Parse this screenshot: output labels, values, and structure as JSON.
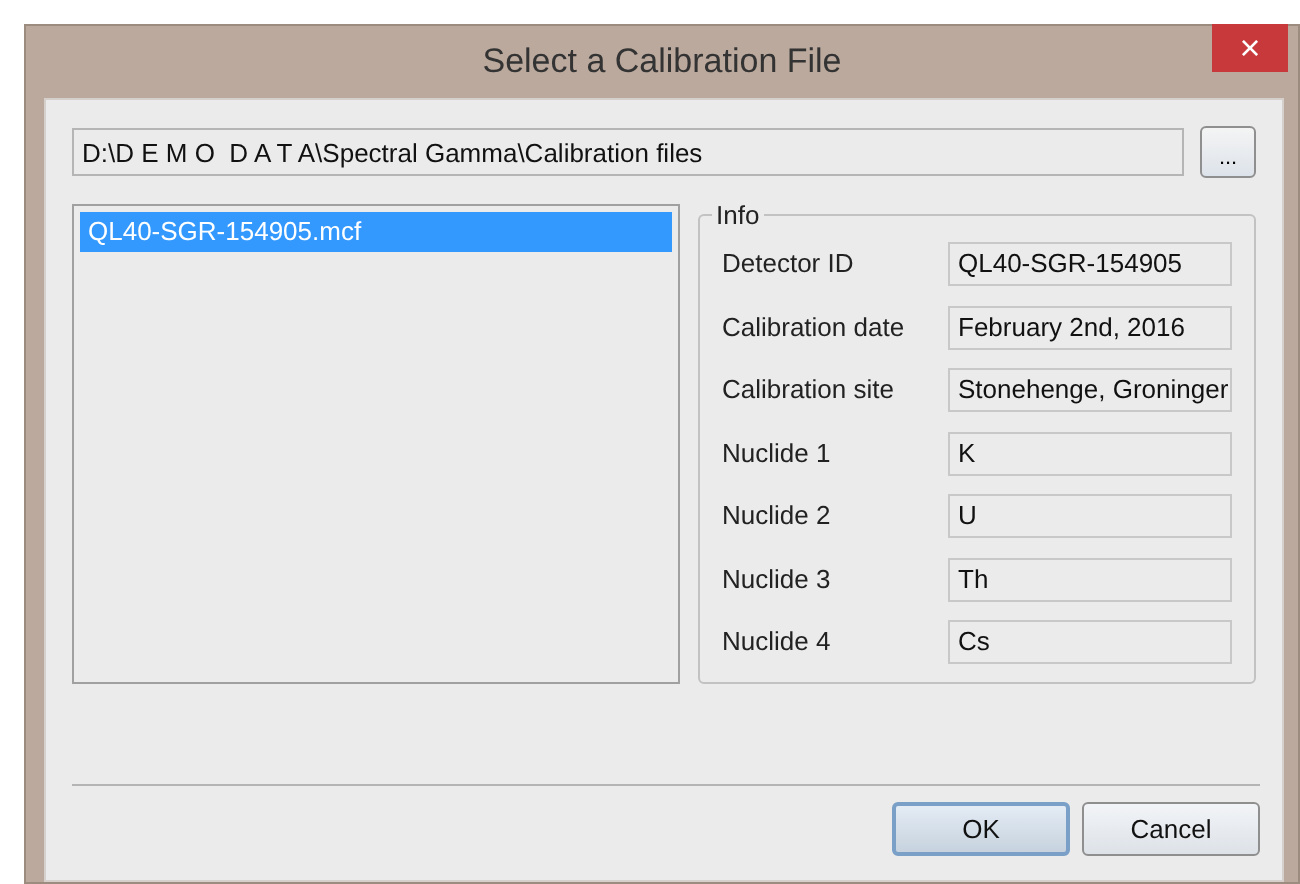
{
  "window": {
    "title": "Select a Calibration File",
    "close": "×"
  },
  "path": {
    "value": "D:\\D E M O  D A T A\\Spectral Gamma\\Calibration files"
  },
  "browse_button": "...",
  "files": [
    {
      "name": "QL40-SGR-154905.mcf",
      "selected": true
    }
  ],
  "info": {
    "title": "Info",
    "fields": [
      {
        "label": "Detector ID",
        "value": "QL40-SGR-154905"
      },
      {
        "label": "Calibration date",
        "value": "February 2nd, 2016"
      },
      {
        "label": "Calibration site",
        "value": "Stonehenge, Groninger"
      },
      {
        "label": "Nuclide 1",
        "value": "K"
      },
      {
        "label": "Nuclide 2",
        "value": "U"
      },
      {
        "label": "Nuclide 3",
        "value": "Th"
      },
      {
        "label": "Nuclide 4",
        "value": "Cs"
      }
    ]
  },
  "buttons": [
    {
      "label": "OK",
      "kind": "default"
    },
    {
      "label": "Cancel",
      "kind": "normal"
    }
  ]
}
